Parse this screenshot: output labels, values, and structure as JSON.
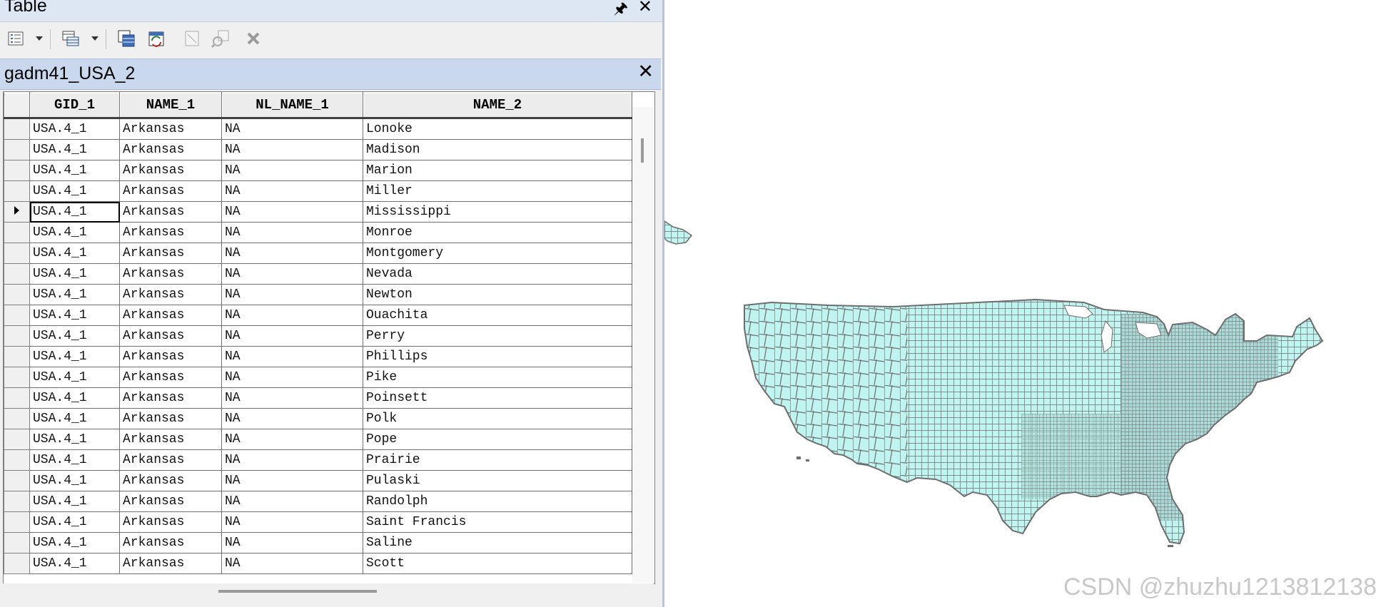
{
  "window": {
    "title": "Table"
  },
  "tab": {
    "title": "gadm41_USA_2"
  },
  "toolbar": {
    "buttons": [
      "table-options-icon",
      "related-tables-icon",
      "select-by-attributes-icon",
      "switch-selection-icon",
      "clear-selection-icon",
      "zoom-to-selected-icon",
      "delete-selected-icon"
    ]
  },
  "table": {
    "columns": [
      "GID_1",
      "NAME_1",
      "NL_NAME_1",
      "NAME_2"
    ],
    "current_row": 4,
    "rows": [
      [
        "USA.4_1",
        "Arkansas",
        "NA",
        "Lonoke"
      ],
      [
        "USA.4_1",
        "Arkansas",
        "NA",
        "Madison"
      ],
      [
        "USA.4_1",
        "Arkansas",
        "NA",
        "Marion"
      ],
      [
        "USA.4_1",
        "Arkansas",
        "NA",
        "Miller"
      ],
      [
        "USA.4_1",
        "Arkansas",
        "NA",
        "Mississippi"
      ],
      [
        "USA.4_1",
        "Arkansas",
        "NA",
        "Monroe"
      ],
      [
        "USA.4_1",
        "Arkansas",
        "NA",
        "Montgomery"
      ],
      [
        "USA.4_1",
        "Arkansas",
        "NA",
        "Nevada"
      ],
      [
        "USA.4_1",
        "Arkansas",
        "NA",
        "Newton"
      ],
      [
        "USA.4_1",
        "Arkansas",
        "NA",
        "Ouachita"
      ],
      [
        "USA.4_1",
        "Arkansas",
        "NA",
        "Perry"
      ],
      [
        "USA.4_1",
        "Arkansas",
        "NA",
        "Phillips"
      ],
      [
        "USA.4_1",
        "Arkansas",
        "NA",
        "Pike"
      ],
      [
        "USA.4_1",
        "Arkansas",
        "NA",
        "Poinsett"
      ],
      [
        "USA.4_1",
        "Arkansas",
        "NA",
        "Polk"
      ],
      [
        "USA.4_1",
        "Arkansas",
        "NA",
        "Pope"
      ],
      [
        "USA.4_1",
        "Arkansas",
        "NA",
        "Prairie"
      ],
      [
        "USA.4_1",
        "Arkansas",
        "NA",
        "Pulaski"
      ],
      [
        "USA.4_1",
        "Arkansas",
        "NA",
        "Randolph"
      ],
      [
        "USA.4_1",
        "Arkansas",
        "NA",
        "Saint Francis"
      ],
      [
        "USA.4_1",
        "Arkansas",
        "NA",
        "Saline"
      ],
      [
        "USA.4_1",
        "Arkansas",
        "NA",
        "Scott"
      ]
    ]
  },
  "map": {
    "fill_color": "#bff4f0",
    "outline_color": "#6e6e6e"
  },
  "watermark": "CSDN @zhuzhu1213812138"
}
